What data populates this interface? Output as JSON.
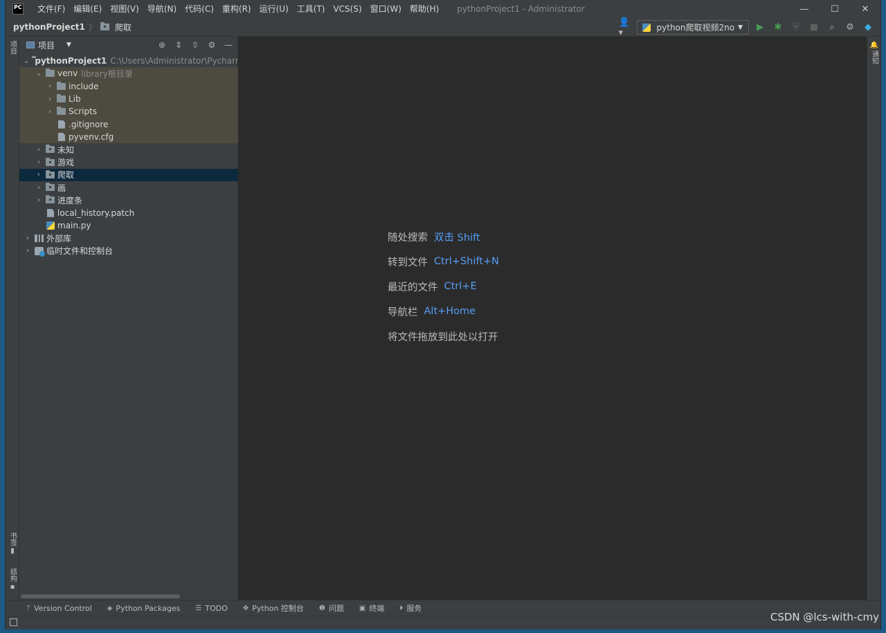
{
  "titlebar": {
    "logo": "PC",
    "menu": [
      "文件(F)",
      "编辑(E)",
      "视图(V)",
      "导航(N)",
      "代码(C)",
      "重构(R)",
      "运行(U)",
      "工具(T)",
      "VCS(S)",
      "窗口(W)",
      "帮助(H)"
    ],
    "title": "pythonProject1 - Administrator",
    "controls": {
      "minimize": "—",
      "maximize": "☐",
      "close": "✕"
    }
  },
  "navbar": {
    "root": "pythonProject1",
    "separator": "〉",
    "current": "爬取",
    "run_config": "python爬取视频2no"
  },
  "left_stripe": {
    "project": "项目",
    "bookmarks": "书签",
    "structure": "结构"
  },
  "right_stripe": {
    "notifications": "通知"
  },
  "project_panel": {
    "title": "项目",
    "tree": {
      "root": {
        "name": "pythonProject1",
        "path": "C:\\Users\\Administrator\\PycharmPr"
      },
      "venv": {
        "name": "venv",
        "hint": "library根目录"
      },
      "include": "include",
      "lib": "Lib",
      "scripts": "Scripts",
      "gitignore": ".gitignore",
      "pyvenv": "pyvenv.cfg",
      "unknown": "未知",
      "game": "游戏",
      "crawl": "爬取",
      "draw": "画",
      "progress": "进度条",
      "patch": "local_history.patch",
      "main": "main.py",
      "ext_libs": "外部库",
      "scratches": "临时文件和控制台"
    }
  },
  "editor_hints": [
    {
      "label": "随处搜索",
      "key": "双击 Shift"
    },
    {
      "label": "转到文件",
      "key": "Ctrl+Shift+N"
    },
    {
      "label": "最近的文件",
      "key": "Ctrl+E"
    },
    {
      "label": "导航栏",
      "key": "Alt+Home"
    },
    {
      "label": "将文件拖放到此处以打开",
      "key": ""
    }
  ],
  "bottom_tools": [
    "Version Control",
    "Python Packages",
    "TODO",
    "Python 控制台",
    "问题",
    "终端",
    "服务"
  ],
  "watermark": "CSDN @lcs-with-cmy",
  "colors": {
    "background": "#2b2b2b",
    "panel": "#3c3f41",
    "selected": "#0d293e",
    "library": "#4d4a3f",
    "hint_key": "#589df6"
  }
}
